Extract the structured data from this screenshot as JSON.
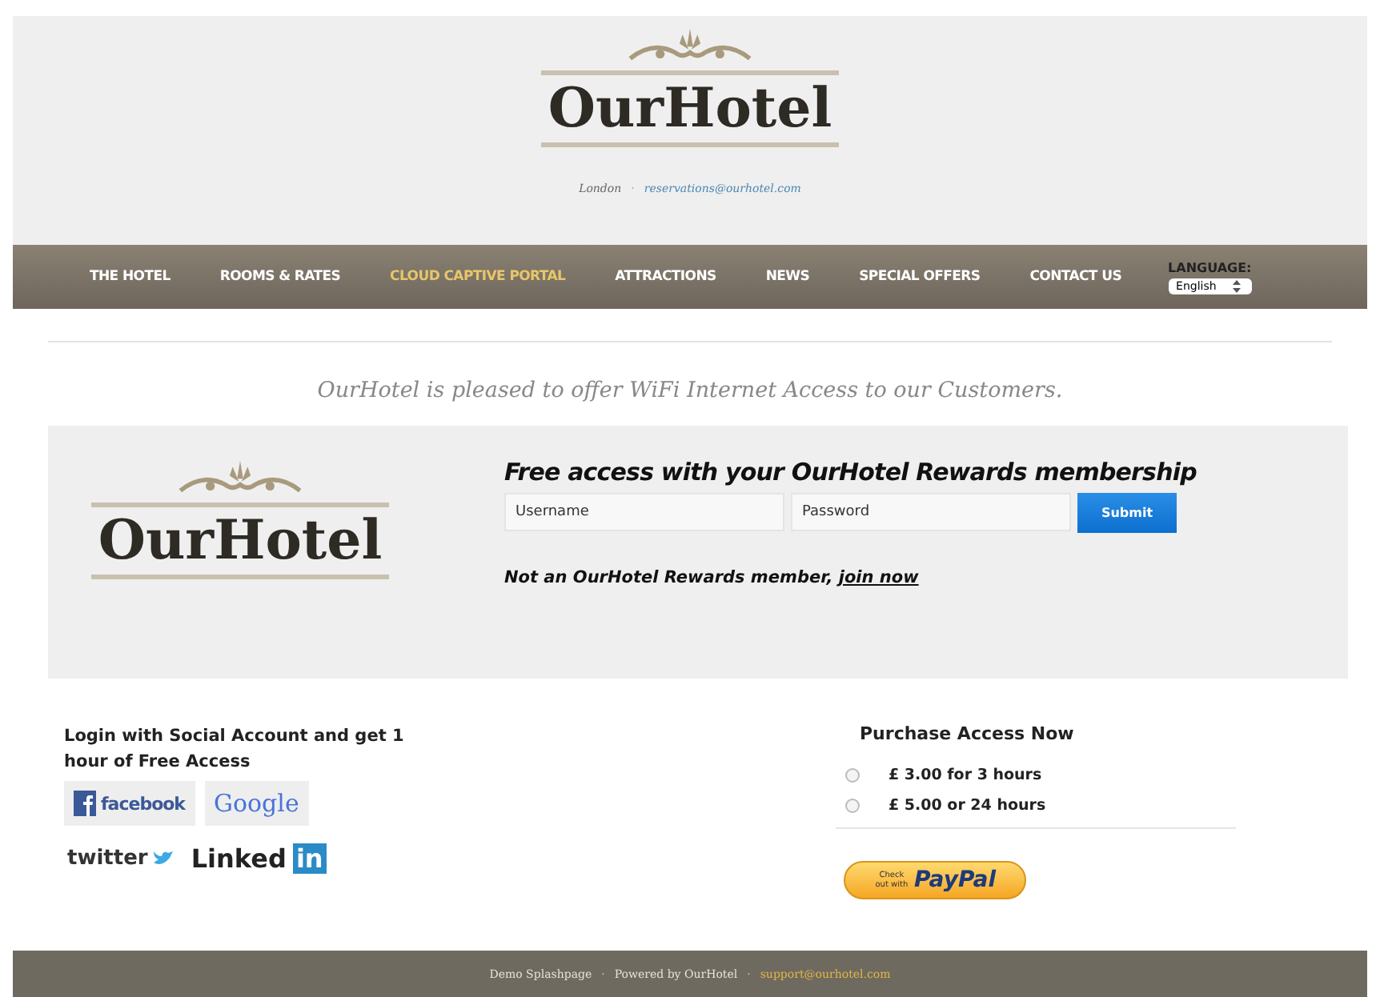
{
  "header": {
    "brand": "OurHotel",
    "city": "London",
    "separator": "·",
    "email": "reservations@ourhotel.com"
  },
  "nav": {
    "items": [
      {
        "label": "THE HOTEL",
        "selected": false
      },
      {
        "label": "ROOMS & RATES",
        "selected": false
      },
      {
        "label": "CLOUD CAPTIVE PORTAL",
        "selected": true
      },
      {
        "label": "ATTRACTIONS",
        "selected": false
      },
      {
        "label": "NEWS",
        "selected": false
      },
      {
        "label": "SPECIAL OFFERS",
        "selected": false
      },
      {
        "label": "CONTACT US",
        "selected": false
      }
    ],
    "language_label": "LANGUAGE:",
    "language": "English"
  },
  "tagline": "OurHotel is pleased to offer WiFi Internet Access to our Customers.",
  "login": {
    "brand": "OurHotel",
    "title": "Free access with your OurHotel Rewards membership",
    "username_placeholder": "Username",
    "password_placeholder": "Password",
    "submit": "Submit",
    "join_text": "Not an OurHotel Rewards member,",
    "join_link": "join now"
  },
  "social": {
    "title": "Login with Social Account and get 1 hour of Free Access",
    "buttons": [
      {
        "kind": "facebook",
        "label": "facebook"
      },
      {
        "kind": "google",
        "label": "Google"
      },
      {
        "kind": "twitter",
        "label": "twitter"
      },
      {
        "kind": "linkedin",
        "label": "Linked",
        "badge": "in"
      }
    ]
  },
  "purchase": {
    "title": "Purchase Access Now",
    "options": [
      {
        "label": "£ 3.00 for 3 hours",
        "selected": false
      },
      {
        "label": "£ 5.00 or 24 hours",
        "selected": false
      }
    ],
    "paypal_small": "Check out with",
    "paypal": "PayPal"
  },
  "footer": [
    {
      "kind": "text",
      "text": "Demo Splashpage"
    },
    {
      "kind": "separator",
      "text": "·"
    },
    {
      "kind": "text",
      "text": "Powered by OurHotel"
    },
    {
      "kind": "separator",
      "text": "·"
    },
    {
      "kind": "link",
      "text": "support@ourhotel.com"
    }
  ]
}
